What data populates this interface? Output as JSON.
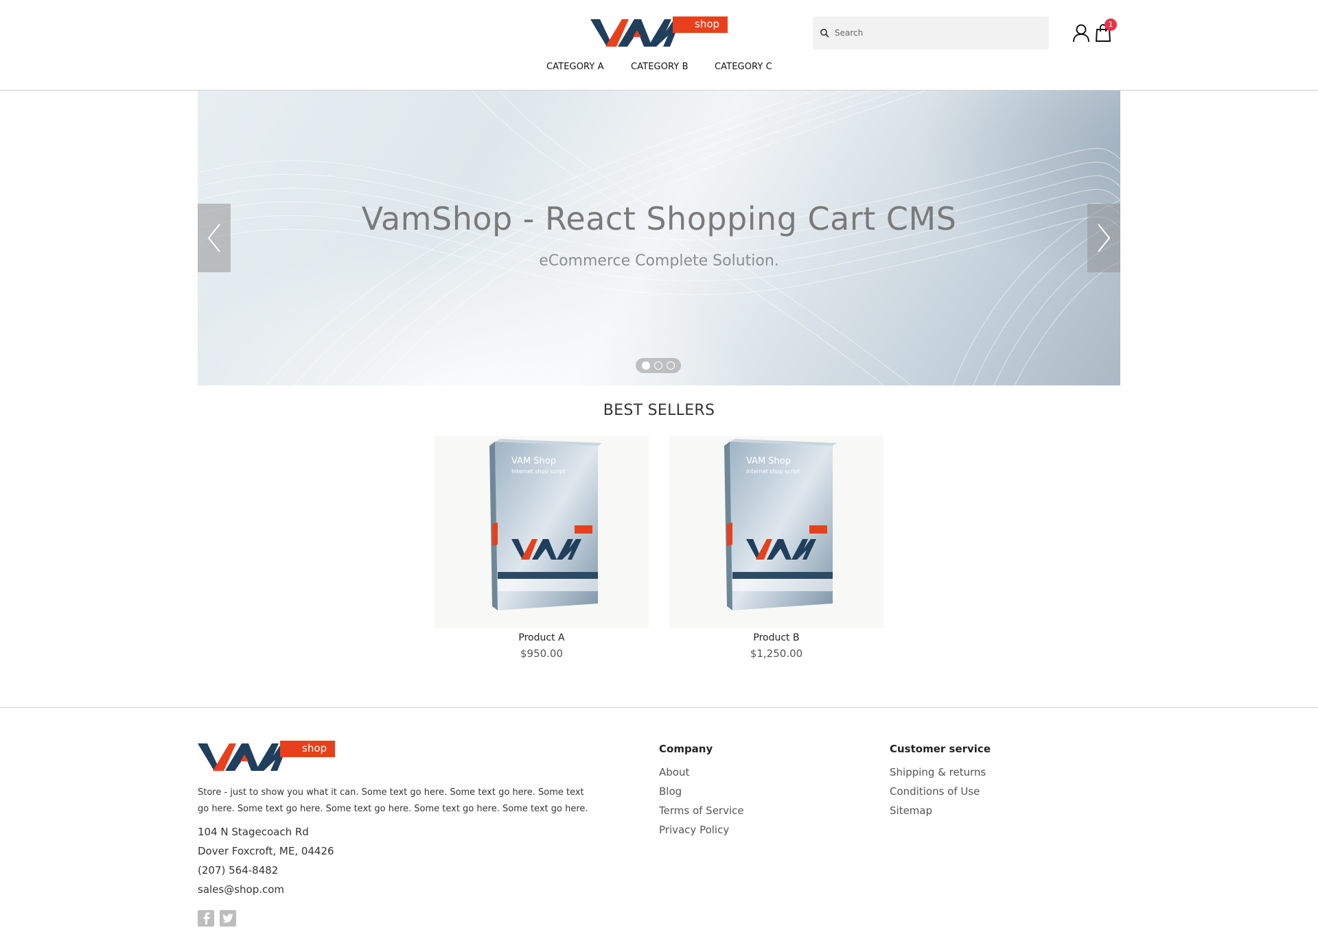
{
  "header": {
    "logo": {
      "text_main": "VAM",
      "text_badge": "shop",
      "icon": "vam-shop-logo"
    },
    "search": {
      "placeholder": "Search",
      "icon": "search-icon"
    },
    "user_icon": "user-icon",
    "cart": {
      "icon": "shopping-bag-icon",
      "count": "1"
    }
  },
  "nav": {
    "items": [
      {
        "label": "CATEGORY A"
      },
      {
        "label": "CATEGORY B"
      },
      {
        "label": "CATEGORY C"
      }
    ]
  },
  "slider": {
    "title": "VamShop - React Shopping Cart CMS",
    "subtitle": "eCommerce Complete Solution.",
    "slide_count": 3,
    "active_slide": 1,
    "prev_icon": "chevron-left-icon",
    "next_icon": "chevron-right-icon"
  },
  "best_sellers": {
    "title": "BEST SELLERS",
    "products": [
      {
        "name": "Product A",
        "price": "$950.00",
        "box_title": "VAM Shop",
        "box_subtitle": "Internet shop\nscript"
      },
      {
        "name": "Product B",
        "price": "$1,250.00",
        "box_title": "VAM Shop",
        "box_subtitle": "Internet shop\nscript"
      }
    ]
  },
  "footer": {
    "description": "Store - just to show you what it can. Some text go here. Some text go here. Some text go here. Some text go here. Some text go here. Some text go here. Some text go here.",
    "address_line1": "104 N Stagecoach Rd",
    "address_line2": "Dover Foxcroft, ME, 04426",
    "phone": "(207) 564-8482",
    "email": "sales@shop.com",
    "social": [
      "facebook-icon",
      "twitter-icon"
    ],
    "company": {
      "title": "Company",
      "links": [
        "About",
        "Blog",
        "Terms of Service",
        "Privacy Policy"
      ]
    },
    "customer_service": {
      "title": "Customer service",
      "links": [
        "Shipping & returns",
        "Conditions of Use",
        "Sitemap"
      ]
    }
  },
  "colors": {
    "logo_dark": "#1f3f5c",
    "logo_red": "#e8401c",
    "badge_red": "#e8334a",
    "text_gray": "#7a7a7a"
  }
}
